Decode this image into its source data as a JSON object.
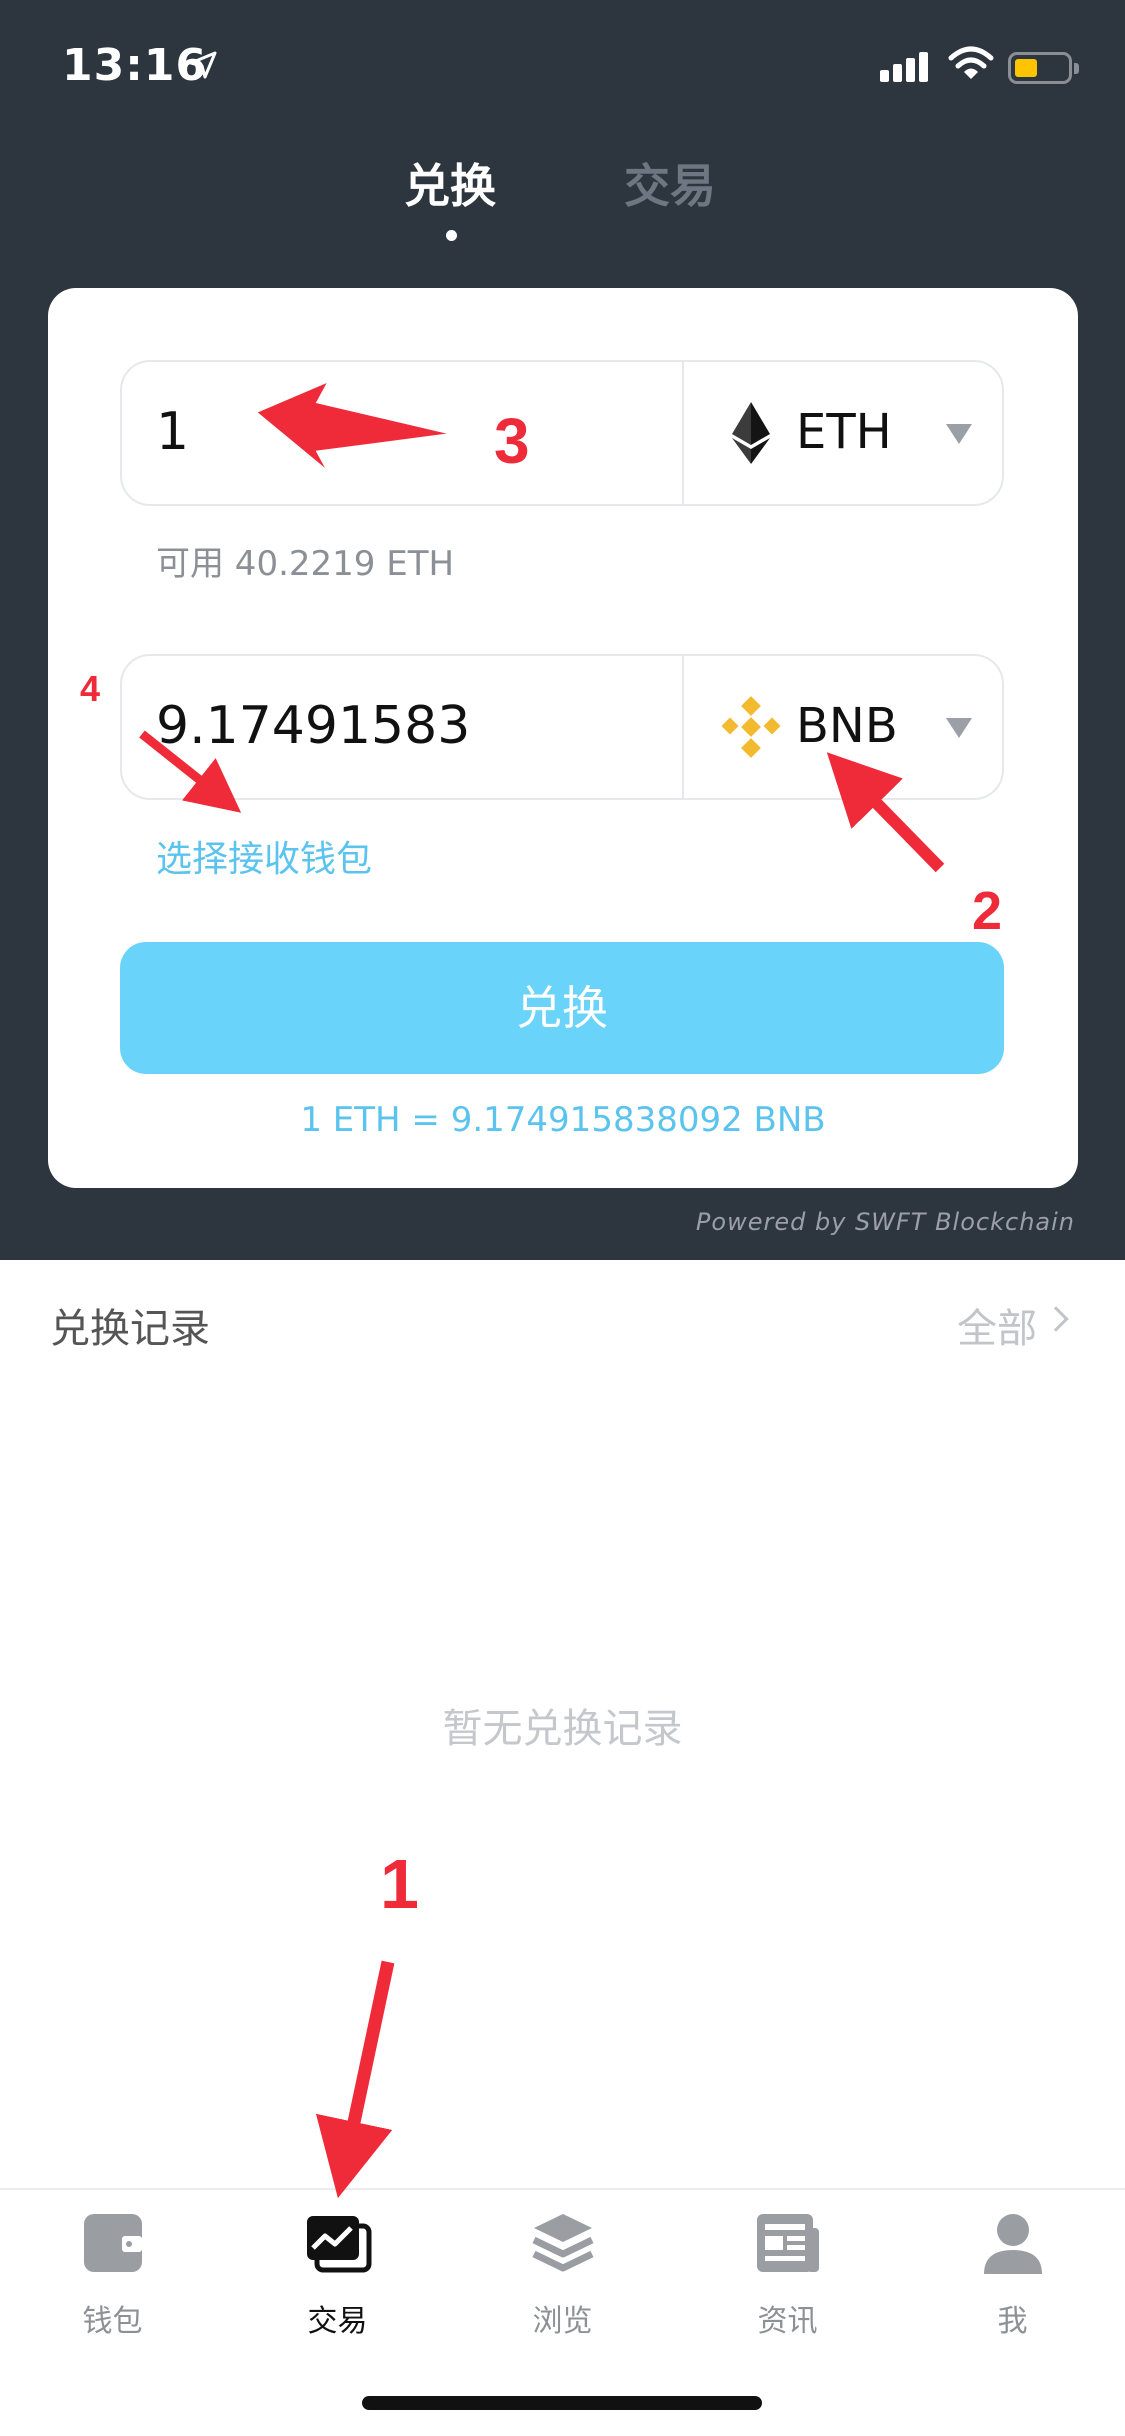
{
  "status_bar": {
    "time": "13:16"
  },
  "top_tabs": {
    "swap": "兑换",
    "trade": "交易"
  },
  "swap_form": {
    "from_amount": "1",
    "from_coin": "ETH",
    "available": "可用 40.2219 ETH",
    "to_amount": "9.17491583",
    "to_coin": "BNB",
    "wallet_link": "选择接收钱包",
    "swap_button": "兑换",
    "rate": "1 ETH = 9.174915838092 BNB"
  },
  "powered_by": "Powered by SWFT Blockchain",
  "history": {
    "title": "兑换记录",
    "all": "全部",
    "empty": "暂无兑换记录"
  },
  "tab_bar": {
    "items": [
      {
        "label": "钱包",
        "icon": "wallet-icon"
      },
      {
        "label": "交易",
        "icon": "trade-chart-icon",
        "active": true
      },
      {
        "label": "浏览",
        "icon": "layers-icon"
      },
      {
        "label": "资讯",
        "icon": "news-icon"
      },
      {
        "label": "我",
        "icon": "profile-icon"
      }
    ]
  },
  "annotations": {
    "n1": "1",
    "n2": "2",
    "n3": "3",
    "n4": "4"
  },
  "colors": {
    "header_bg": "#2d353f",
    "accent": "#6ad3fa",
    "link": "#5bc4ee",
    "bnb": "#f3ba2f",
    "annotation": "#ef2b3a"
  }
}
